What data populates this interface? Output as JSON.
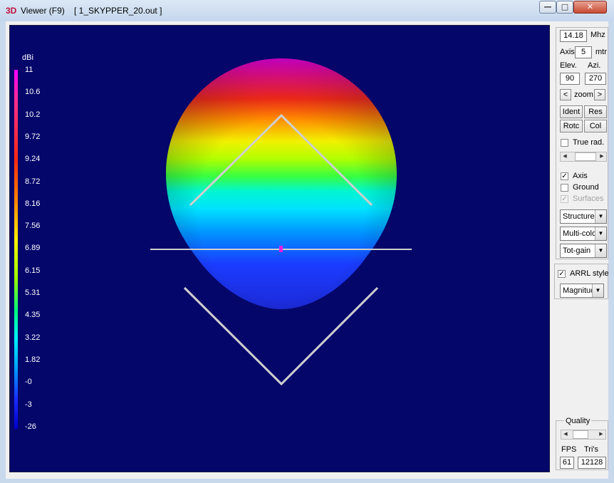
{
  "window": {
    "title": "Viewer (F9)",
    "file": "[  1_SKYPPER_20.out ]",
    "icon": "3D",
    "controls": [
      "minimize-icon",
      "maximize-icon",
      "close-icon"
    ]
  },
  "legend": {
    "unit": "dBi",
    "labels": [
      "11",
      "10.6",
      "10.2",
      "9.72",
      "9.24",
      "8.72",
      "8.16",
      "7.56",
      "6.89",
      "6.15",
      "5.31",
      "4.35",
      "3.22",
      "1.82",
      "-0",
      "-3",
      "-26"
    ]
  },
  "panel": {
    "frequency": "14.18",
    "freq_unit": "Mhz",
    "axis_label": "Axis",
    "axis_value": "5",
    "axis_unit": "mtr",
    "elev_label": "Elev.",
    "azi_label": "Azi.",
    "elev_value": "90",
    "azi_value": "270",
    "zoom_label": "zoom",
    "zoom_left": "<",
    "zoom_right": ">",
    "buttons": {
      "ident": "Ident",
      "res": "Res",
      "rotc": "Rotc",
      "col": "Col"
    },
    "true_rad_label": "True rad.",
    "true_rad_checked": false,
    "axis_check_label": "Axis",
    "axis_checked": true,
    "ground_label": "Ground",
    "ground_checked": false,
    "surfaces_label": "Surfaces",
    "surfaces_checked": true,
    "dropdown_structure": "Structure",
    "dropdown_color": "Multi-colo",
    "dropdown_gain": "Tot-gain",
    "arrl_label": "ARRL style",
    "arrl_checked": true,
    "dropdown_magnitude": "Magnituc",
    "quality_label": "Quality",
    "fps_label": "FPS",
    "tris_label": "Tri's",
    "fps_value": "61",
    "tris_value": "12128"
  },
  "colors": {
    "viewport_bg": "#04066a",
    "wire": "#d0d0d0",
    "title_bar": "#c9d9ec"
  }
}
